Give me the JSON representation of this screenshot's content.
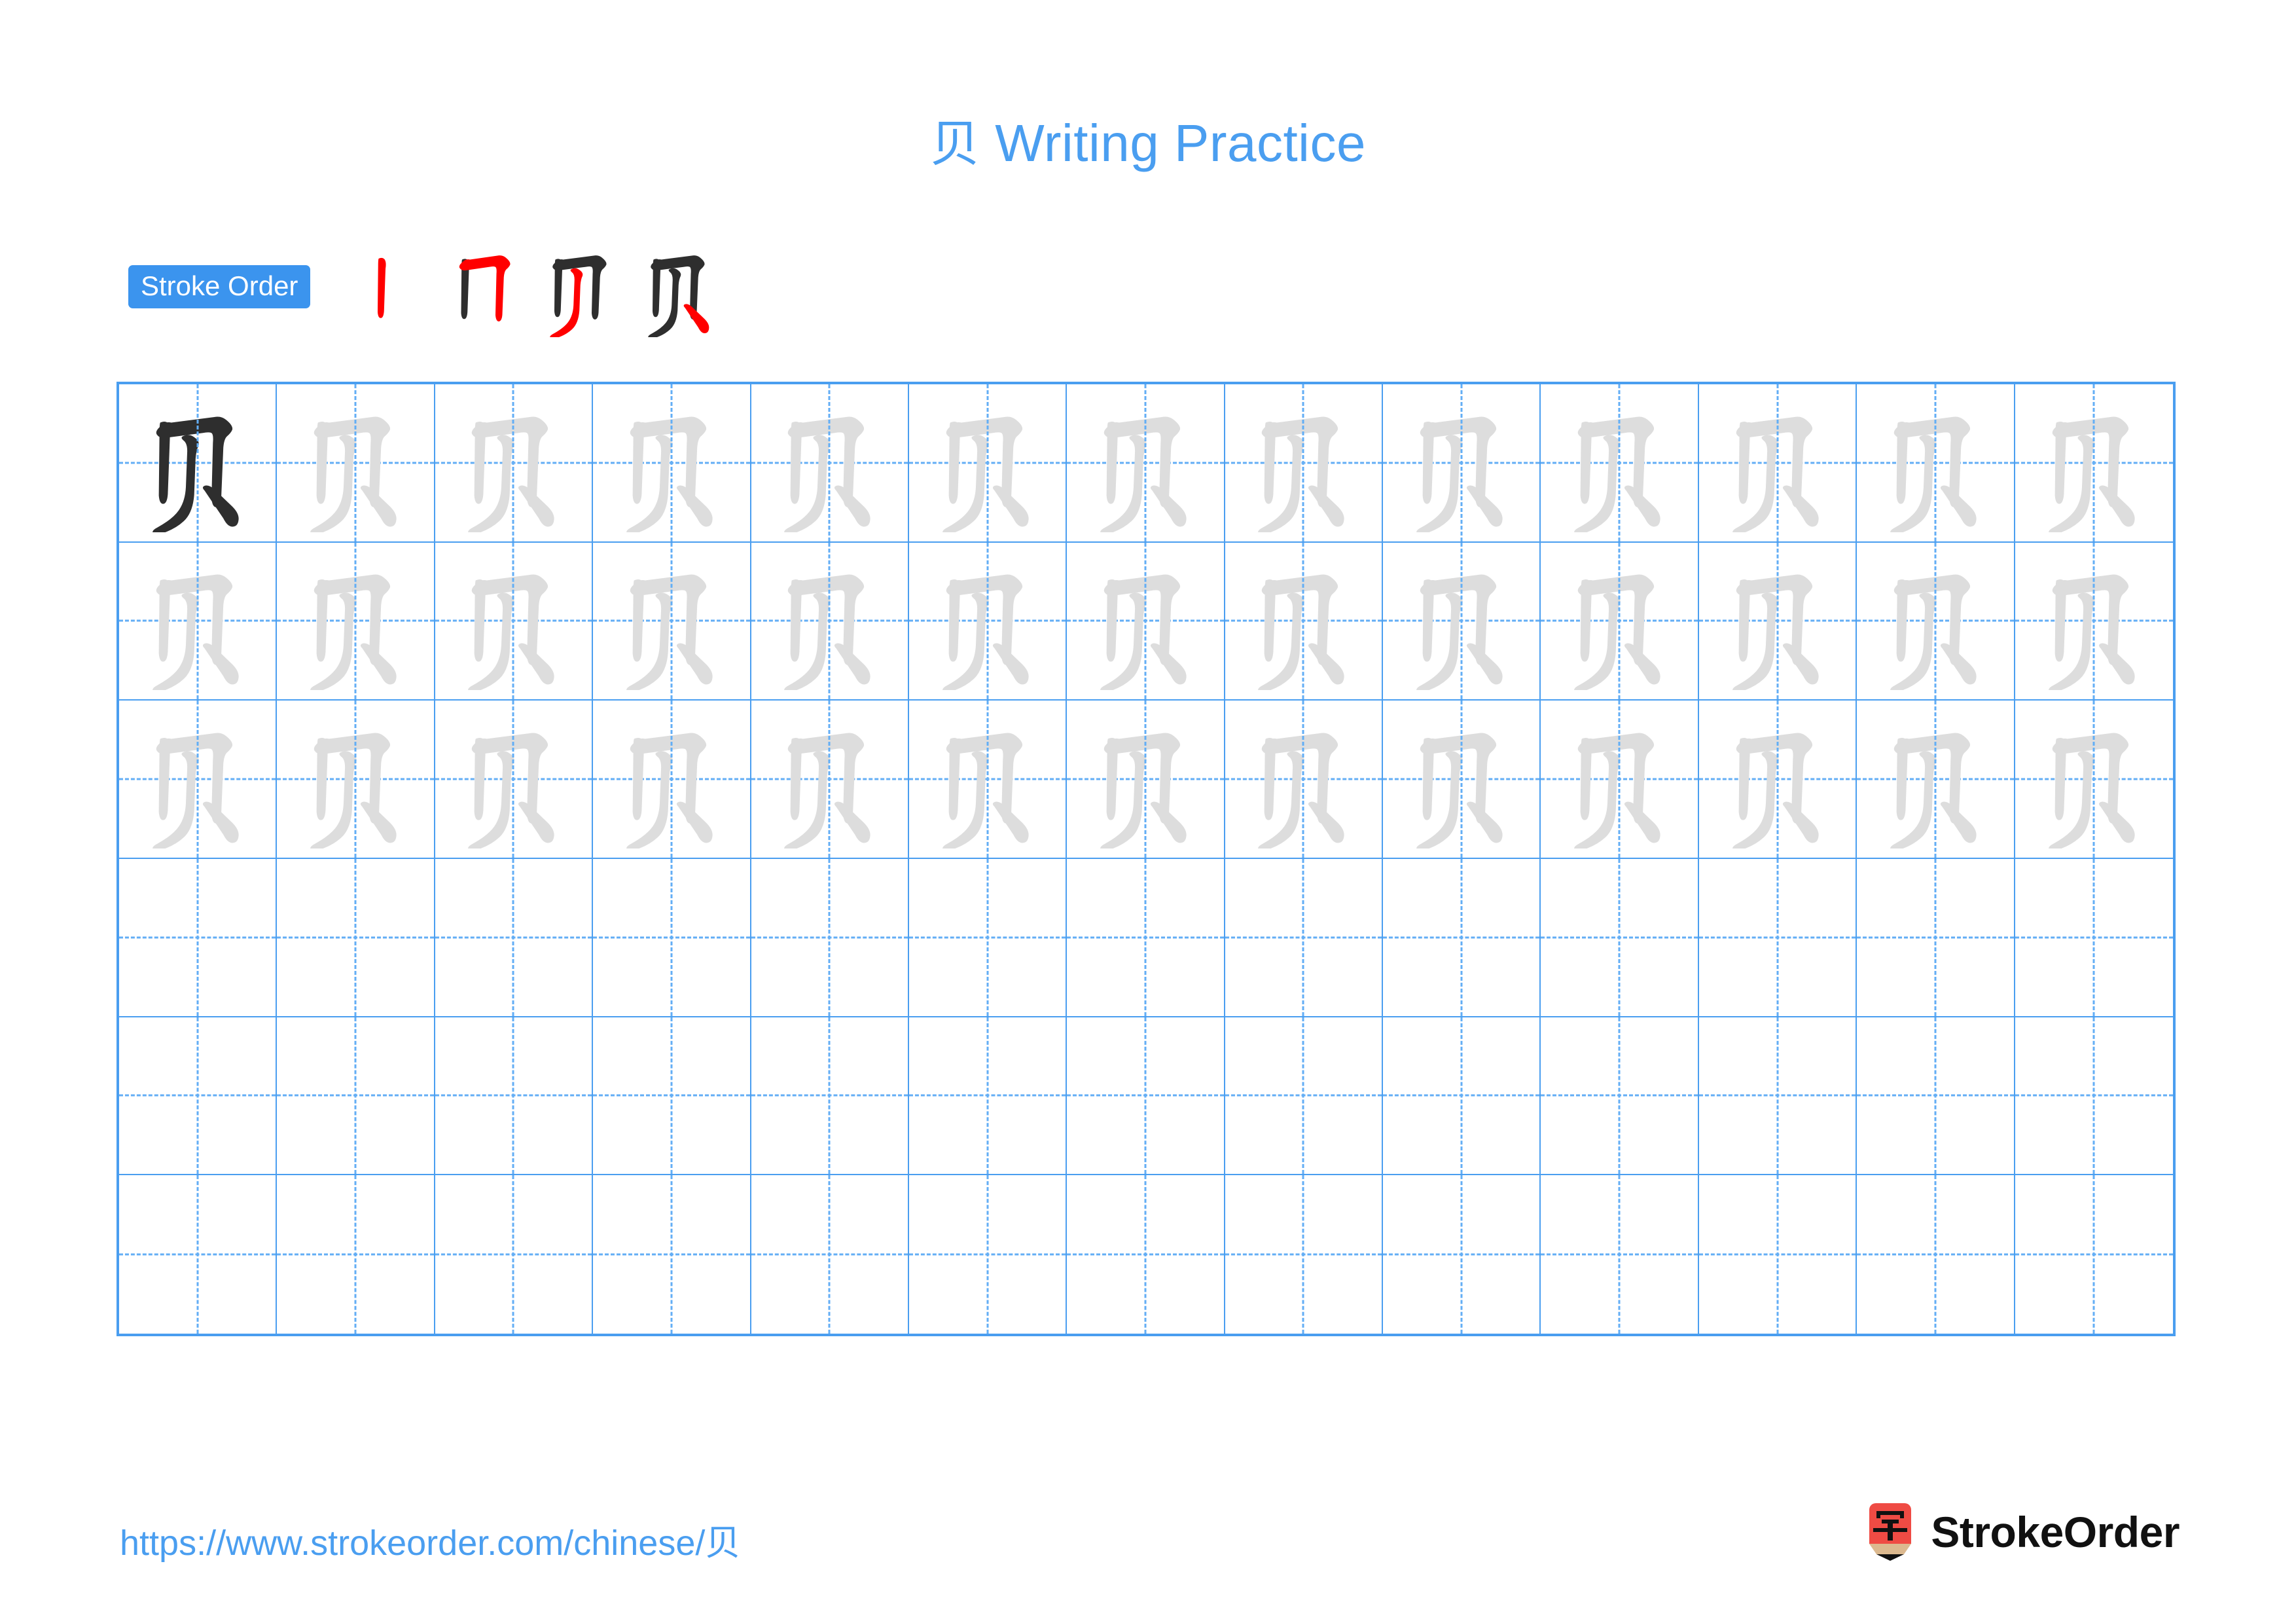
{
  "character": "贝",
  "title": "贝 Writing Practice",
  "title_character": "贝",
  "title_text": " Writing Practice",
  "colors": {
    "accent_blue": "#4a9ef0",
    "badge_blue": "#3b94ee",
    "grid_line": "#4a9ef0",
    "guide_line": "#63aef5",
    "stroke_new": "#ff0000",
    "stroke_done": "#2e2e2e",
    "trace_gray": "#dddddd",
    "logo_red": "#ef4b44",
    "logo_wood": "#dcb98f"
  },
  "stroke_order": {
    "badge_label": "Stroke Order",
    "stroke_count": 4,
    "steps": [
      {
        "index": 1,
        "name": "shu",
        "description": "vertical stroke",
        "new_stroke_color": "#ff0000"
      },
      {
        "index": 2,
        "name": "heng-zhe",
        "description": "horizontal then turn down",
        "new_stroke_color": "#ff0000"
      },
      {
        "index": 3,
        "name": "pie",
        "description": "left-falling stroke",
        "new_stroke_color": "#ff0000"
      },
      {
        "index": 4,
        "name": "dian",
        "description": "dot / right-falling",
        "new_stroke_color": "#ff0000"
      }
    ]
  },
  "practice_grid": {
    "columns": 13,
    "rows": 6,
    "cells": [
      [
        "dark",
        "light",
        "light",
        "light",
        "light",
        "light",
        "light",
        "light",
        "light",
        "light",
        "light",
        "light",
        "light"
      ],
      [
        "light",
        "light",
        "light",
        "light",
        "light",
        "light",
        "light",
        "light",
        "light",
        "light",
        "light",
        "light",
        "light"
      ],
      [
        "light",
        "light",
        "light",
        "light",
        "light",
        "light",
        "light",
        "light",
        "light",
        "light",
        "light",
        "light",
        "light"
      ],
      [
        "empty",
        "empty",
        "empty",
        "empty",
        "empty",
        "empty",
        "empty",
        "empty",
        "empty",
        "empty",
        "empty",
        "empty",
        "empty"
      ],
      [
        "empty",
        "empty",
        "empty",
        "empty",
        "empty",
        "empty",
        "empty",
        "empty",
        "empty",
        "empty",
        "empty",
        "empty",
        "empty"
      ],
      [
        "empty",
        "empty",
        "empty",
        "empty",
        "empty",
        "empty",
        "empty",
        "empty",
        "empty",
        "empty",
        "empty",
        "empty",
        "empty"
      ]
    ]
  },
  "footer": {
    "url": "https://www.strokeorder.com/chinese/贝",
    "brand_name": "StrokeOrder",
    "logo_character": "字"
  }
}
